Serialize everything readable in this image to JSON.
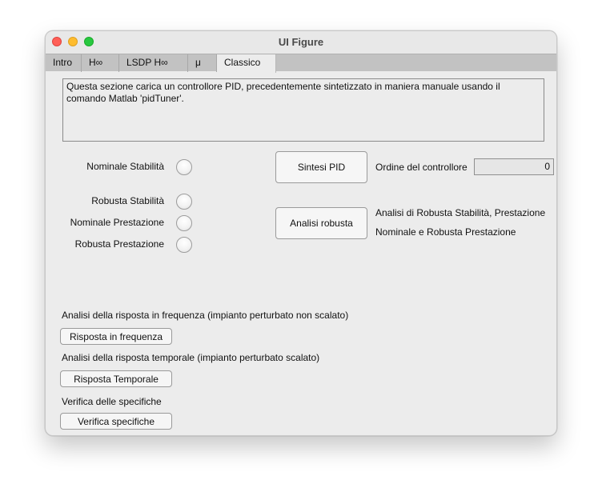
{
  "window": {
    "title": "UI Figure"
  },
  "tabs": [
    {
      "label": "Intro"
    },
    {
      "label": "H∞"
    },
    {
      "label": "LSDP H∞"
    },
    {
      "label": "μ"
    },
    {
      "label": "Classico",
      "selected": true
    }
  ],
  "description": "Questa sezione carica un controllore PID, precedentemente sintetizzato in maniera manuale usando il comando Matlab 'pidTuner'.",
  "indicators": {
    "nominal_stability": "Nominale Stabilità",
    "robust_stability": "Robusta Stabilità",
    "nominal_performance": "Nominale Prestazione",
    "robust_performance": "Robusta Prestazione"
  },
  "buttons": {
    "pid_synthesis": "Sintesi PID",
    "robust_analysis": "Analisi robusta",
    "frequency_response": "Risposta in frequenza",
    "time_response": "Risposta Temporale",
    "verify_specs": "Verifica specifiche"
  },
  "controller_order": {
    "label": "Ordine del controllore",
    "value": "0"
  },
  "robust_analysis_note": {
    "line1": "Analisi di Robusta Stabilità, Prestazione",
    "line2": "Nominale e Robusta Prestazione"
  },
  "sections": {
    "frequency": "Analisi della risposta in frequenza (impianto perturbato non scalato)",
    "temporal": "Analisi della risposta temporale (impianto perturbato scalato)",
    "specs": "Verifica delle specifiche"
  },
  "colors": {
    "close": "#ff5f57",
    "minimize": "#febc2e",
    "maximize": "#28c840",
    "tabbar": "#c2c2c2",
    "panel": "#ececec"
  }
}
